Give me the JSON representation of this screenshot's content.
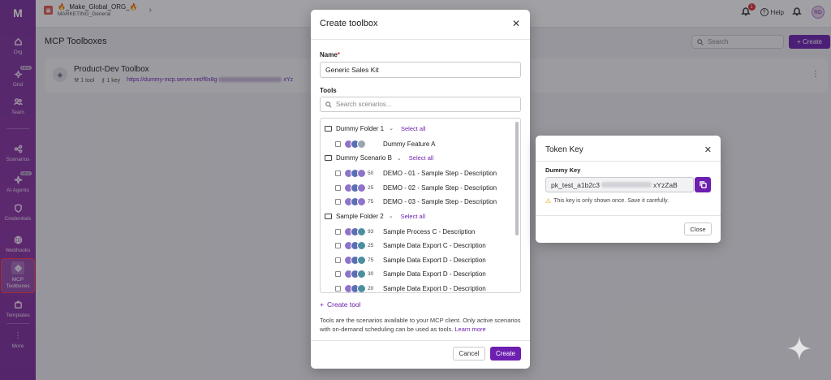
{
  "sidebar": {
    "logo": "M",
    "items": [
      {
        "label": "Org",
        "icon": "home-icon"
      },
      {
        "label": "Grid",
        "icon": "grid-icon",
        "badge": "NEW"
      },
      {
        "label": "Team",
        "icon": "team-icon"
      },
      {
        "label": "Scenarios",
        "icon": "share-icon"
      },
      {
        "label": "AI Agents",
        "icon": "ai-agent-icon",
        "badge": "NEW"
      },
      {
        "label": "Credentials",
        "icon": "shield-icon"
      },
      {
        "label": "Webhooks",
        "icon": "globe-icon"
      },
      {
        "label": "MCP Toolboxes",
        "icon": "mcp-icon"
      },
      {
        "label": "Templates",
        "icon": "template-icon"
      },
      {
        "label": "More",
        "icon": "more-icon"
      }
    ]
  },
  "topbar": {
    "org_name": "🔥_Make_Global_ORG_🔥",
    "team_name": "MARKETING_General",
    "notification_count": "1",
    "help_label": "Help",
    "avatar_initials": "RD"
  },
  "page": {
    "title": "MCP Toolboxes",
    "search_placeholder": "Search",
    "create_label": "+ Create",
    "toolbox": {
      "name": "Product-Dev Toolbox",
      "tool_count": "1 tool",
      "key_count": "1 key",
      "url_start": "https://dummy-mcp.server.net/f6x8g",
      "url_end": "xYz"
    }
  },
  "create_modal": {
    "title": "Create toolbox",
    "name_label": "Name",
    "name_required": "*",
    "name_value": "Generic Sales Kit",
    "tools_label": "Tools",
    "search_placeholder": "Search scenarios...",
    "select_all": "Select all",
    "folders": [
      {
        "name": "Dummy Folder 1",
        "scenarios": [
          {
            "name": "Dummy Feature A",
            "num": "",
            "colors": [
              "#8f73c9",
              "#5b6fb5",
              "#9aa5b1"
            ]
          }
        ]
      },
      {
        "name": "Dummy Scenario B",
        "scenarios": [
          {
            "name": "DEMO - 01 - Sample Step - Description",
            "num": "50",
            "colors": [
              "#8f73c9",
              "#5b6fb5",
              "#8f73c9"
            ]
          },
          {
            "name": "DEMO - 02 - Sample Step - Description",
            "num": "25",
            "colors": [
              "#8f73c9",
              "#5b6fb5",
              "#8f73c9"
            ]
          },
          {
            "name": "DEMO - 03 - Sample Step - Description",
            "num": "75",
            "colors": [
              "#8f73c9",
              "#5b6fb5",
              "#8f73c9"
            ]
          }
        ]
      },
      {
        "name": "Sample Folder 2",
        "scenarios": [
          {
            "name": "Sample Process C - Description",
            "num": "93",
            "colors": [
              "#8f73c9",
              "#5b6fb5",
              "#4c8ea0"
            ]
          },
          {
            "name": "Sample Data Export C - Description",
            "num": "25",
            "colors": [
              "#8f73c9",
              "#5b6fb5",
              "#4c8ea0"
            ]
          },
          {
            "name": "Sample Data Export D - Description",
            "num": "75",
            "colors": [
              "#8f73c9",
              "#5b6fb5",
              "#4c8ea0"
            ]
          },
          {
            "name": "Sample Data Export D - Description",
            "num": "30",
            "colors": [
              "#8f73c9",
              "#5b6fb5",
              "#4c8ea0"
            ]
          },
          {
            "name": "Sample Data Export D - Description",
            "num": "20",
            "colors": [
              "#8f73c9",
              "#5b6fb5",
              "#4c8ea0"
            ]
          }
        ]
      }
    ],
    "create_tool_label": "Create tool",
    "help_text": "Tools are the scenarios available to your MCP client. Only active scenarios with on-demand scheduling can be used as tools.",
    "learn_more": "Learn more",
    "cancel_label": "Cancel",
    "create_label": "Create"
  },
  "token_dialog": {
    "title": "Token Key",
    "key_label": "Dummy Key",
    "key_start": "pk_test_a1b2c3",
    "key_end": "xYzZaB",
    "warning": "This key is only shown once. Save it carefully.",
    "close_label": "Close"
  },
  "colors": {
    "brand": "#6d1fb0",
    "sidebar": "#7b2f9e",
    "active_outline": "#ff3b3b"
  }
}
